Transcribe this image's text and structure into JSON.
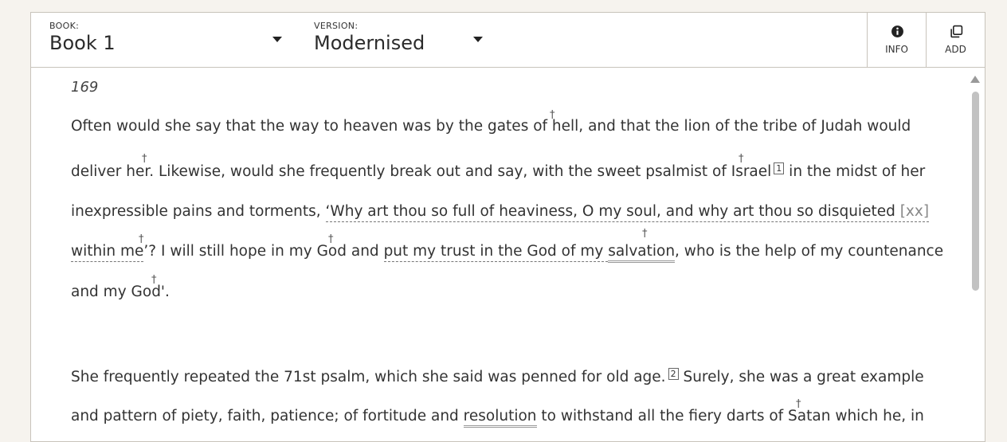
{
  "toolbar": {
    "book": {
      "label": "BOOK:",
      "value": "Book 1"
    },
    "version": {
      "label": "VERSION:",
      "value": "Modernised"
    },
    "info_label": "INFO",
    "add_label": "ADD"
  },
  "icons": {
    "info": "info-circle-icon",
    "add": "copy-add-icon",
    "caret": "caret-down-icon",
    "dagger": "dagger-icon"
  },
  "document": {
    "page_number": "169",
    "para1": {
      "l1": "Often would she say that the way to heaven was by the gates of hell, and that the lion of the tribe of Judah would",
      "l2a": "deliver her. Likewise, would she frequently break out and say, with the sweet psalmist of Israel",
      "fn1": "1",
      "l2b": " in the midst of her",
      "l3a": "inexpressible pains and torments, ",
      "l3b": "‘Why art thou so full of heaviness, O my soul, and why art thou so disquieted ",
      "l3c": "[xx]",
      "l4a": "within me",
      "l4b": "’? I will still hope in my God and ",
      "l4c": "put my trust in the God of my ",
      "l4d": "salvation",
      "l4e": ", who is the help of my countenance",
      "l5": "and my God'."
    },
    "para2": {
      "l1a": "She frequently repeated the 71st psalm, which she said was penned for old age.",
      "fn2": "2",
      "l1b": " Surely, she was a great example",
      "l2a": "and pattern of piety, faith, patience; of fortitude and ",
      "l2b": "resolution",
      "l2c": " to withstand all the fiery darts of Satan which he, in"
    },
    "dagger_glyph": "†"
  },
  "colors": {
    "background": "#f6f3ee",
    "panel": "#ffffff",
    "border": "#c8c3bb",
    "text": "#333333"
  }
}
